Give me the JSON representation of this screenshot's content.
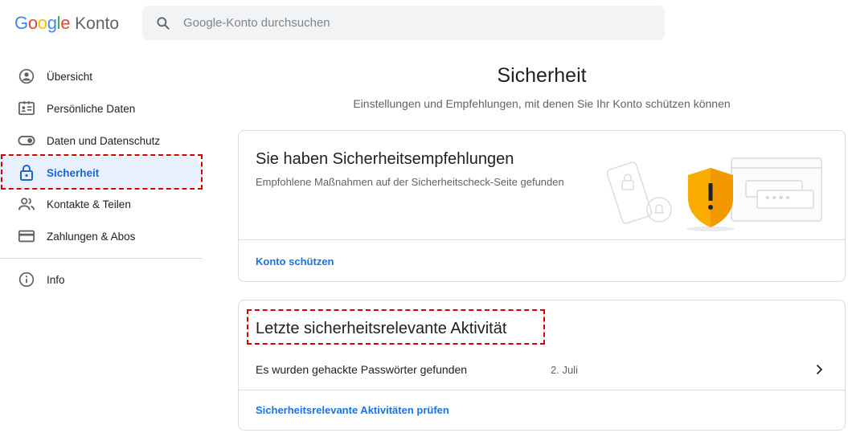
{
  "header": {
    "logo_letters": [
      {
        "ch": "G",
        "color": "#4285F4"
      },
      {
        "ch": "o",
        "color": "#EA4335"
      },
      {
        "ch": "o",
        "color": "#FBBC05"
      },
      {
        "ch": "g",
        "color": "#4285F4"
      },
      {
        "ch": "l",
        "color": "#34A853"
      },
      {
        "ch": "e",
        "color": "#EA4335"
      }
    ],
    "logo_word": "Google",
    "logo_suffix": "Konto",
    "search_placeholder": "Google-Konto durchsuchen",
    "search_icon": "search-icon"
  },
  "sidebar": {
    "items": [
      {
        "label": "Übersicht",
        "icon": "account-circle-icon",
        "active": false
      },
      {
        "label": "Persönliche Daten",
        "icon": "id-card-icon",
        "active": false
      },
      {
        "label": "Daten und Datenschutz",
        "icon": "toggle-icon",
        "active": false
      },
      {
        "label": "Sicherheit",
        "icon": "lock-icon",
        "active": true
      },
      {
        "label": "Kontakte & Teilen",
        "icon": "people-icon",
        "active": false
      },
      {
        "label": "Zahlungen & Abos",
        "icon": "credit-card-icon",
        "active": false
      }
    ],
    "info": {
      "label": "Info",
      "icon": "info-icon"
    }
  },
  "main": {
    "title": "Sicherheit",
    "subtitle": "Einstellungen und Empfehlungen, mit denen Sie Ihr Konto schützen können",
    "recommendations": {
      "heading": "Sie haben Sicherheitsempfehlungen",
      "description": "Empfohlene Maßnahmen auf der Sicherheitscheck-Seite gefunden",
      "link": "Konto schützen",
      "illustration_text": "****"
    },
    "activity": {
      "heading": "Letzte sicherheitsrelevante Aktivität",
      "rows": [
        {
          "text": "Es wurden gehackte Passwörter gefunden",
          "date": "2. Juli"
        }
      ],
      "link": "Sicherheitsrelevante Aktivitäten prüfen"
    }
  },
  "colors": {
    "accent": "#1a73e8",
    "active_bg": "#e8f0fe",
    "highlight": "#d60000",
    "shield": "#f9ab00"
  }
}
